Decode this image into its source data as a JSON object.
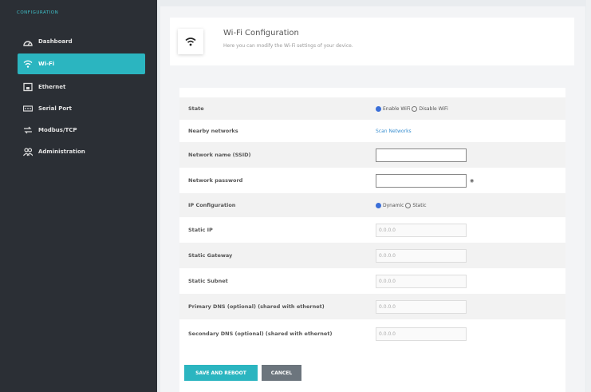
{
  "sidebar": {
    "section_label": "CONFIGURATION",
    "items": [
      {
        "label": "Dashboard",
        "icon": "dashboard-icon"
      },
      {
        "label": "Wi-Fi",
        "icon": "wifi-icon",
        "active": true
      },
      {
        "label": "Ethernet",
        "icon": "ethernet-icon"
      },
      {
        "label": "Serial Port",
        "icon": "serial-port-icon"
      },
      {
        "label": "Modbus/TCP",
        "icon": "modbus-icon"
      },
      {
        "label": "Administration",
        "icon": "admin-icon"
      }
    ]
  },
  "header": {
    "title": "Wi-Fi Configuration",
    "subtitle": "Here you can modify the Wi-Fi settings of your device.",
    "icon": "wifi-icon"
  },
  "form": {
    "state": {
      "label": "State",
      "options": [
        "Enable WiFi",
        "Disable WiFi"
      ],
      "selected": "Enable WiFi"
    },
    "nearby": {
      "label": "Nearby networks",
      "link": "Scan Networks"
    },
    "ssid": {
      "label": "Network name (SSID)",
      "value": ""
    },
    "password": {
      "label": "Network password",
      "value": ""
    },
    "ip_config": {
      "label": "IP Configuration",
      "options": [
        "Dynamic",
        "Static"
      ],
      "selected": "Dynamic"
    },
    "static_ip": {
      "label": "Static IP",
      "value": "0.0.0.0"
    },
    "static_gateway": {
      "label": "Static Gateway",
      "value": "0.0.0.0"
    },
    "static_subnet": {
      "label": "Static Subnet",
      "value": "0.0.0.0"
    },
    "primary_dns": {
      "label": "Primary DNS (optional) (shared with ethernet)",
      "value": "0.0.0.0"
    },
    "secondary_dns": {
      "label": "Secondary DNS (optional) (shared with ethernet)",
      "value": "0.0.0.0"
    }
  },
  "buttons": {
    "save": "SAVE AND REBOOT",
    "cancel": "CANCEL"
  },
  "colors": {
    "accent": "#2bb5c0",
    "sidebar": "#2b2f35",
    "cancel": "#6c757d"
  }
}
